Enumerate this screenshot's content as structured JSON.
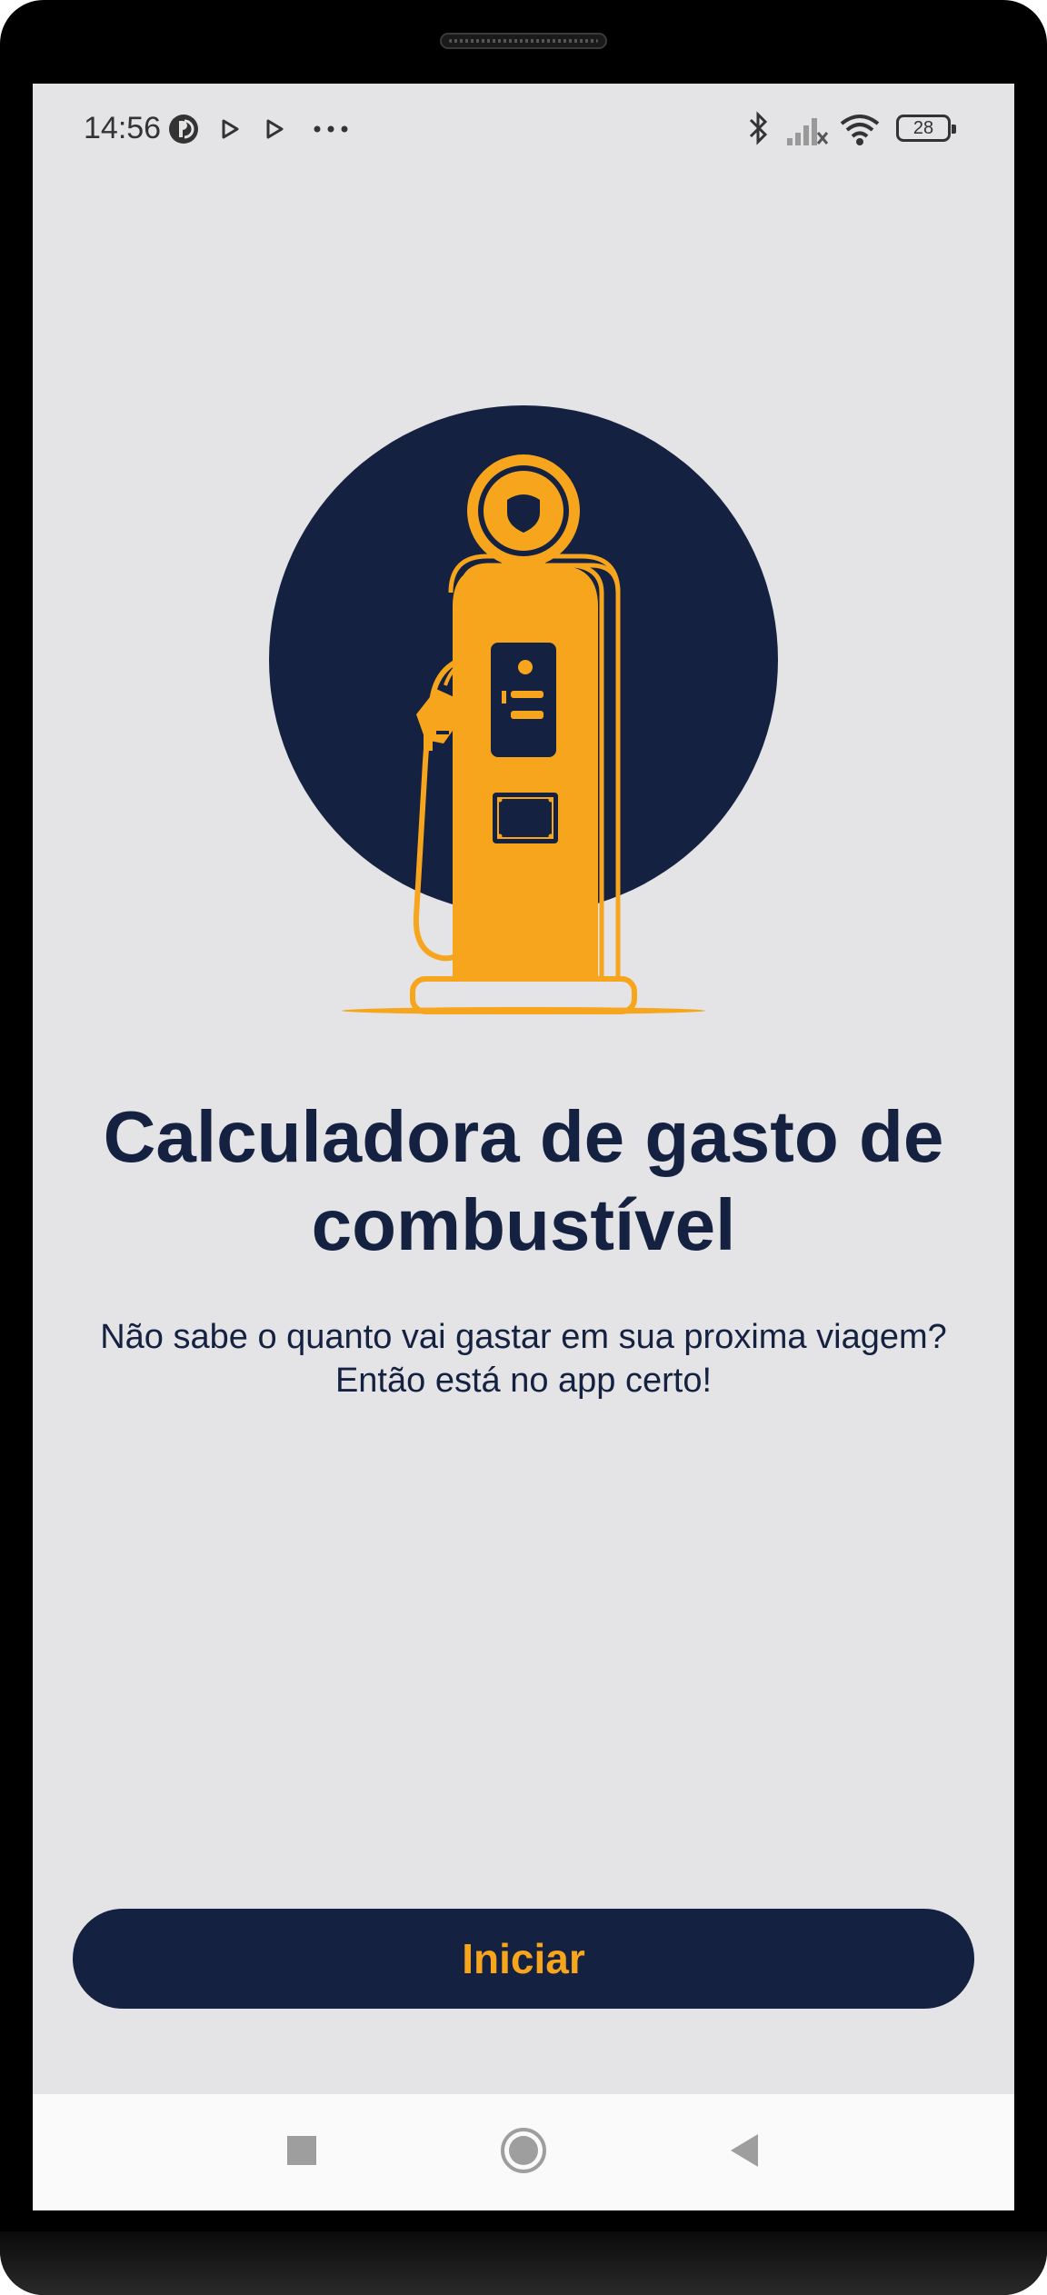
{
  "status_bar": {
    "time": "14:56",
    "battery_level": "28",
    "icons": [
      "sync-icon",
      "play-icon",
      "play-icon",
      "more-dots-icon",
      "bluetooth-icon",
      "signal-icon",
      "wifi-icon",
      "battery-icon"
    ]
  },
  "hero": {
    "illustration": "fuel-pump-icon",
    "circle_color": "#152140",
    "pump_color": "#f6a51d"
  },
  "main": {
    "title": "Calculadora de gasto de combustível",
    "subtitle_line1": "Não sabe o quanto vai gastar em sua proxima viagem?",
    "subtitle_line2": "Então está no app certo!",
    "start_button_label": "Iniciar"
  },
  "nav_bar": {
    "items": [
      "recents-icon",
      "home-icon",
      "back-icon"
    ]
  },
  "colors": {
    "background": "#e4e3e5",
    "primary": "#152140",
    "accent": "#f6a51d"
  }
}
